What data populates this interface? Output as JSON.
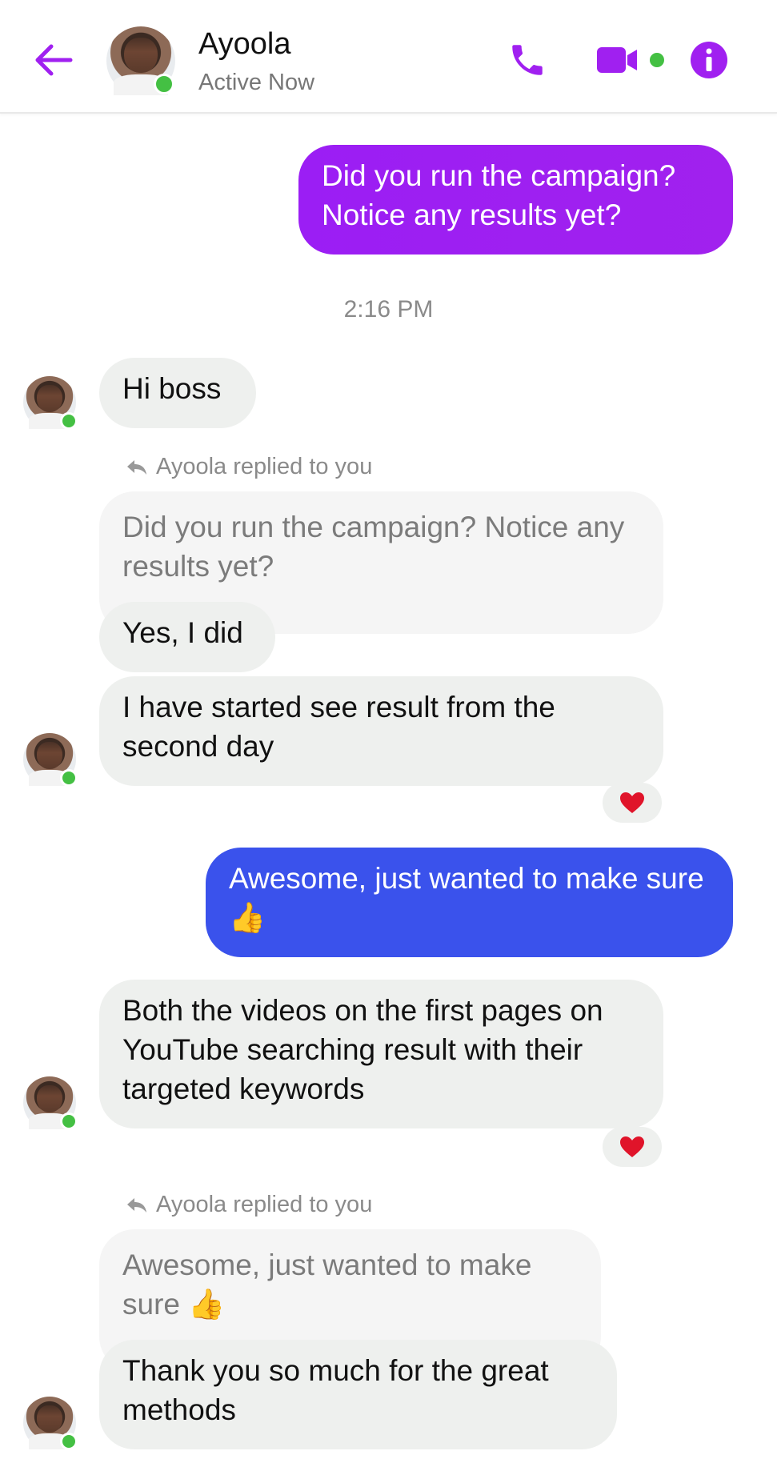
{
  "header": {
    "contact_name": "Ayoola",
    "status": "Active Now",
    "icons": [
      "back-arrow-icon",
      "phone-icon",
      "video-camera-icon",
      "info-icon"
    ],
    "accent_color": "#a020f0"
  },
  "messages": {
    "m1": "Did you run the campaign? Notice any results yet?",
    "timestamp": "2:16 PM",
    "m2": "Hi boss",
    "reply_label_1": "Ayoola replied to you",
    "quote_1": "Did you run the campaign?  Notice any results yet?",
    "m3": "Yes, I did",
    "m4": "I have started see result from the second day",
    "reaction_1": "❤️",
    "m5": "Awesome, just wanted to make sure 👍",
    "m6": "Both the videos on the first pages on YouTube searching result with their targeted keywords",
    "reaction_2": "❤️",
    "reply_label_2": "Ayoola replied to you",
    "quote_2": "Awesome, just wanted to make sure 👍",
    "m7": "Thank you so much for the great methods"
  },
  "colors": {
    "outgoing_purple": "#a020f0",
    "outgoing_blue": "#3a52ec",
    "incoming_bg": "#eef0ee",
    "online_dot": "#44c043"
  }
}
